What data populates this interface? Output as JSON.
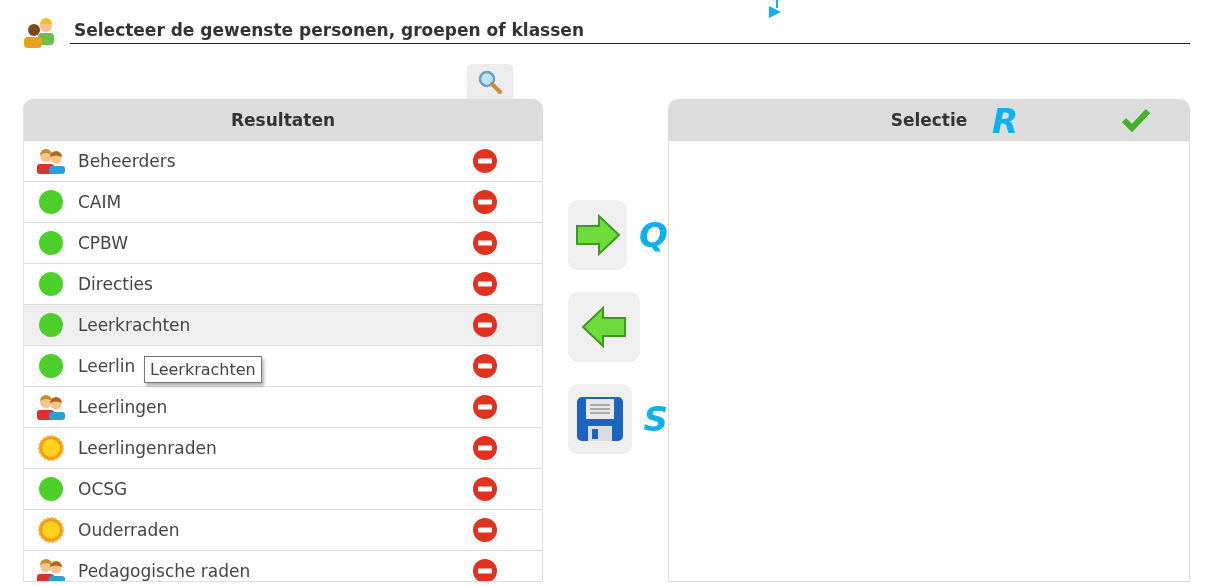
{
  "header": {
    "title": "Selecteer de gewenste personen, groepen of klassen"
  },
  "results": {
    "title": "Resultaten",
    "items": [
      {
        "kind": "group",
        "label": "Beheerders",
        "hovered": false
      },
      {
        "kind": "dot",
        "label": "CAIM",
        "hovered": false
      },
      {
        "kind": "dot",
        "label": "CPBW",
        "hovered": false
      },
      {
        "kind": "dot",
        "label": "Directies",
        "hovered": false
      },
      {
        "kind": "dot",
        "label": "Leerkrachten",
        "hovered": true
      },
      {
        "kind": "dot",
        "label": "Leerlin",
        "hovered": false
      },
      {
        "kind": "group",
        "label": "Leerlingen",
        "hovered": false
      },
      {
        "kind": "sun",
        "label": "Leerlingenraden",
        "hovered": false
      },
      {
        "kind": "dot",
        "label": "OCSG",
        "hovered": false
      },
      {
        "kind": "sun",
        "label": "Ouderraden",
        "hovered": false
      },
      {
        "kind": "group",
        "label": "Pedagogische raden",
        "hovered": false
      }
    ]
  },
  "tooltip": {
    "text": "Leerkrachten"
  },
  "move_buttons": [
    {
      "kind": "add",
      "annotation": "Q"
    },
    {
      "kind": "remove"
    },
    {
      "kind": "save",
      "annotation": "S"
    }
  ],
  "selection": {
    "title": "Selectie",
    "annotation": "R"
  }
}
